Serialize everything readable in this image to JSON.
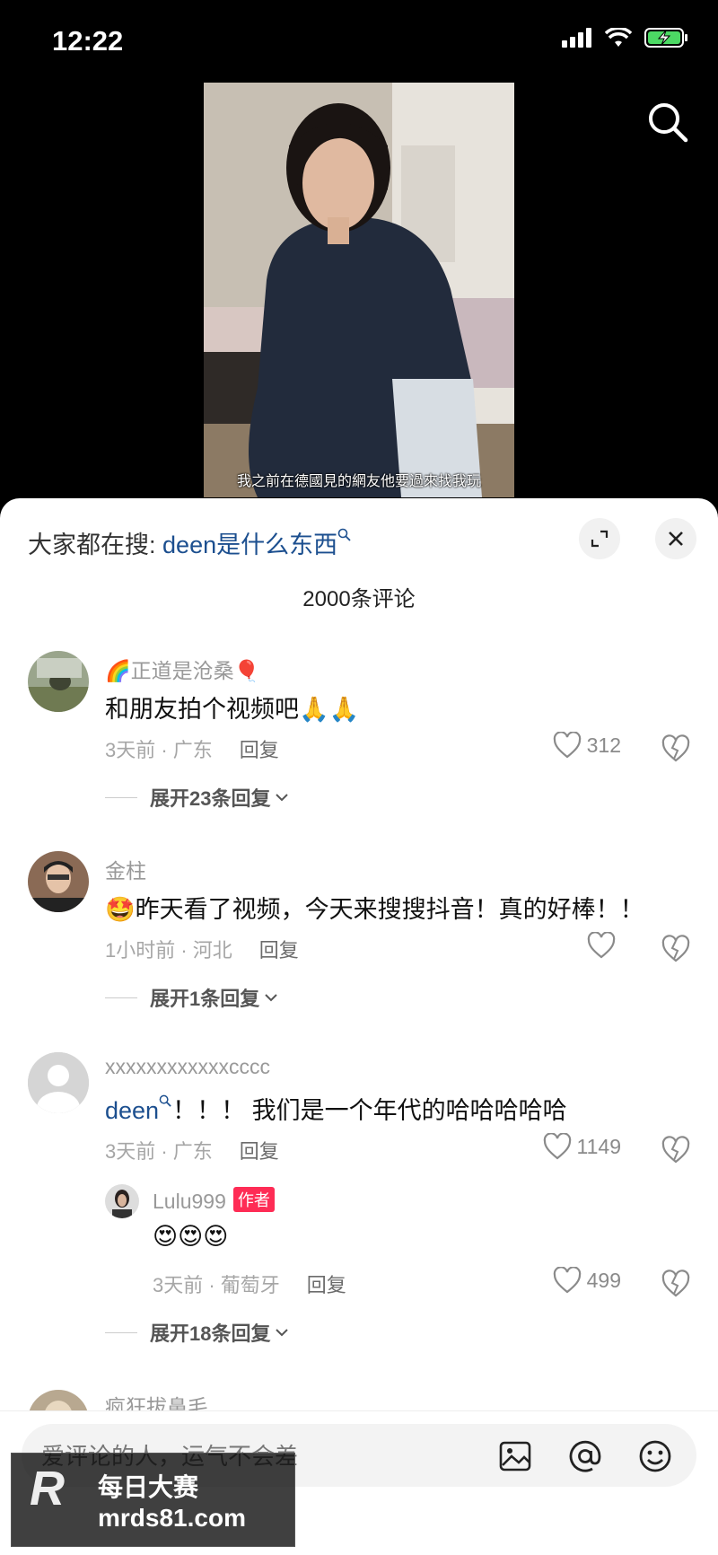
{
  "status_bar": {
    "time": "12:22"
  },
  "video": {
    "subtitle": "我之前在德國見的網友他要過來找我玩"
  },
  "sheet": {
    "search_prefix": "大家都在搜:",
    "search_term": "deen是什么东西",
    "comment_count": "2000条评论"
  },
  "comments": [
    {
      "user": "🌈正道是沧桑🎈",
      "text": "和朋友拍个视频吧🙏🙏",
      "meta": "3天前 · 广东",
      "reply": "回复",
      "likes": "312",
      "expand": "展开23条回复"
    },
    {
      "user": "金柱",
      "text": "🤩昨天看了视频，今天来搜搜抖音！真的好棒！！",
      "meta": "1小时前 · 河北",
      "reply": "回复",
      "likes": "",
      "expand": "展开1条回复"
    },
    {
      "user": "xxxxxxxxxxxxcccc",
      "text_link": "deen",
      "text": "！！！ 我们是一个年代的哈哈哈哈哈",
      "meta": "3天前 · 广东",
      "reply": "回复",
      "likes": "1149",
      "sub_reply": {
        "user": "Lulu999",
        "tag": "作者",
        "text": "😍😍😍",
        "meta": "3天前 · 葡萄牙",
        "reply": "回复",
        "likes": "499"
      },
      "expand": "展开18条回复"
    },
    {
      "user": "疯狂拔鼻毛"
    }
  ],
  "input": {
    "placeholder": "爱评论的人，运气不会差"
  },
  "watermark": {
    "letter": "R",
    "title": "每日大赛",
    "url": "mrds81.com"
  },
  "icons": [
    "signal-icon",
    "wifi-icon",
    "battery-icon",
    "search-icon",
    "expand-icon",
    "close-icon",
    "heart-icon",
    "broken-heart-icon",
    "chevron-down-icon",
    "image-icon",
    "at-icon",
    "emoji-icon"
  ]
}
